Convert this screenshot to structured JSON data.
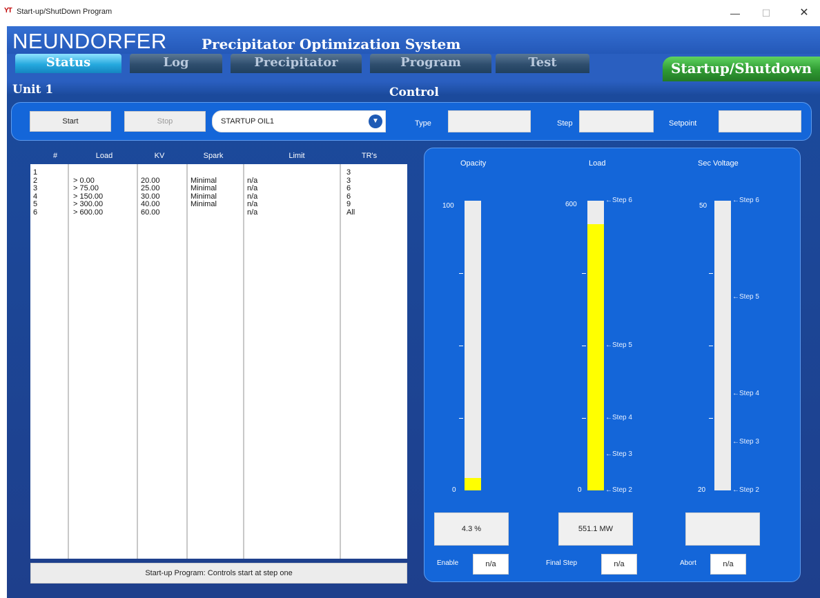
{
  "window": {
    "icon_text": "YT",
    "title": "Start-up/ShutDown Program",
    "minimize": "—",
    "maximize": "☐",
    "close": "✕"
  },
  "header": {
    "brand": "NEUNDORFER",
    "subtitle": "Precipitator Optimization System"
  },
  "tabs": [
    {
      "label": "Status",
      "active": true
    },
    {
      "label": "Log",
      "active": false
    },
    {
      "label": "Precipitator",
      "active": false
    },
    {
      "label": "Program",
      "active": false
    },
    {
      "label": "Test",
      "active": false
    },
    {
      "label": "Startup/Shutdown",
      "active": false
    }
  ],
  "unit_label": "Unit 1",
  "control_label": "Control",
  "controls": {
    "start_label": "Start",
    "stop_label": "Stop",
    "program_selected": "STARTUP OIL1",
    "type_label": "Type",
    "type_value": "",
    "step_label": "Step",
    "step_value": "",
    "setpoint_label": "Setpoint",
    "setpoint_value": ""
  },
  "table": {
    "headers": [
      "#",
      "Load",
      "KV",
      "Spark",
      "Limit",
      "TR's"
    ],
    "rows": [
      [
        "1",
        "",
        "",
        "",
        "",
        "3"
      ],
      [
        "2",
        "> 0.00",
        "20.00",
        "Minimal",
        "n/a",
        "3"
      ],
      [
        "3",
        "> 75.00",
        "25.00",
        "Minimal",
        "n/a",
        "6"
      ],
      [
        "4",
        "> 150.00",
        "30.00",
        "Minimal",
        "n/a",
        "6"
      ],
      [
        "5",
        "> 300.00",
        "40.00",
        "Minimal",
        "n/a",
        "9"
      ],
      [
        "6",
        "> 600.00",
        "60.00",
        "",
        "n/a",
        "All"
      ]
    ],
    "footnote": "Start-up Program: Controls start at step one"
  },
  "gauges": {
    "opacity": {
      "title": "Opacity",
      "max_label": "100",
      "min_label": "0",
      "min": 0,
      "max": 100,
      "value": 4.3,
      "readout": "4.3 %"
    },
    "load": {
      "title": "Load",
      "max_label": "600",
      "min_label": "0",
      "min": 0,
      "max": 600,
      "value": 551.1,
      "readout": "551.1 MW",
      "steps": [
        {
          "label": "Step 6",
          "at": 600
        },
        {
          "label": "Step 5",
          "at": 300
        },
        {
          "label": "Step 4",
          "at": 150
        },
        {
          "label": "Step 3",
          "at": 75
        },
        {
          "label": "Step 2",
          "at": 0
        }
      ]
    },
    "sec_voltage": {
      "title": "Sec Voltage",
      "max_label": "50",
      "min_label": "20",
      "min": 20,
      "max": 50,
      "value": null,
      "readout": "",
      "steps": [
        {
          "label": "Step 6",
          "at": 50
        },
        {
          "label": "Step 5",
          "at": 40
        },
        {
          "label": "Step 4",
          "at": 30
        },
        {
          "label": "Step 3",
          "at": 25
        },
        {
          "label": "Step 2",
          "at": 20
        }
      ]
    }
  },
  "status_fields": {
    "enable_label": "Enable",
    "enable_value": "n/a",
    "final_step_label": "Final Step",
    "final_step_value": "n/a",
    "abort_label": "Abort",
    "abort_value": "n/a"
  },
  "colors": {
    "panel_blue": "#1466d9",
    "bar_fill": "#ffff00",
    "active_tab": "#26a9de",
    "startup_tab": "#2f9a32"
  }
}
